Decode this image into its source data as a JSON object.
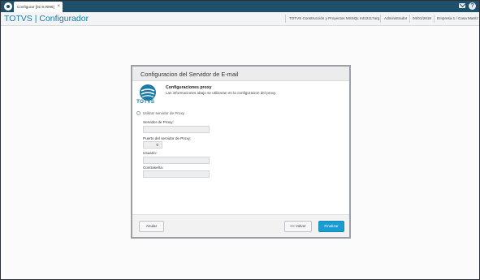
{
  "colors": {
    "topbar": "#1e4f6b",
    "brand": "#1b7aa6",
    "primary_button": "#1a9cd0"
  },
  "topbar": {
    "tab_label": "Configurar [02.9.0096]",
    "tab_close": "×",
    "help": "?"
  },
  "header": {
    "brand": "TOTVS | Configurador",
    "company": "TOTVS Construcción y Proyectos MSSQL Int12117arg",
    "user": "Administrador",
    "date": "04/01/2019",
    "branch": "Empresa 1 / Casa Matriz"
  },
  "icons": {
    "app": "app-logo-icon",
    "mail": "mail-icon",
    "help": "help-icon",
    "totvs": "totvs-logo-icon"
  },
  "dialog": {
    "title": "Configuracion del Servidor de E-mail",
    "logo_text": "TOTVS",
    "section_title": "Configuraciones proxy",
    "section_desc": "Las informaciones abajo se utilizaran en la configuracion del proxy.",
    "use_proxy_label": "Utilizar servidor de Proxy",
    "use_proxy_checked": false,
    "fields": {
      "server_label": "Servidor de Proxy:",
      "server_value": "",
      "port_label": "Puerto del servidor de Proxy:",
      "port_value": "0",
      "user_label": "Usuario:",
      "user_value": "",
      "password_label": "Contraseña:",
      "password_value": ""
    },
    "buttons": {
      "cancel": "Anular",
      "back": "<< Volver",
      "finish": "Finalizar"
    }
  }
}
